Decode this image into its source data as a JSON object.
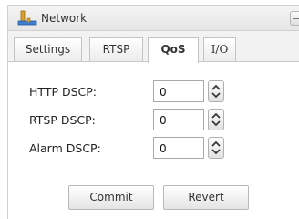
{
  "header": {
    "title": "Network",
    "icon": "network-icon"
  },
  "tabs": [
    {
      "label": "Settings",
      "active": false
    },
    {
      "label": "RTSP",
      "active": false
    },
    {
      "label": "QoS",
      "active": true
    },
    {
      "label": "I/O",
      "active": false
    }
  ],
  "fields": [
    {
      "label": "HTTP DSCP:",
      "value": "0"
    },
    {
      "label": "RTSP DSCP:",
      "value": "0"
    },
    {
      "label": "Alarm DSCP:",
      "value": "0"
    }
  ],
  "buttons": {
    "commit": "Commit",
    "revert": "Revert"
  },
  "colors": {
    "spinner_arrow": "#3a3a3a",
    "border": "#c4c4c4"
  }
}
